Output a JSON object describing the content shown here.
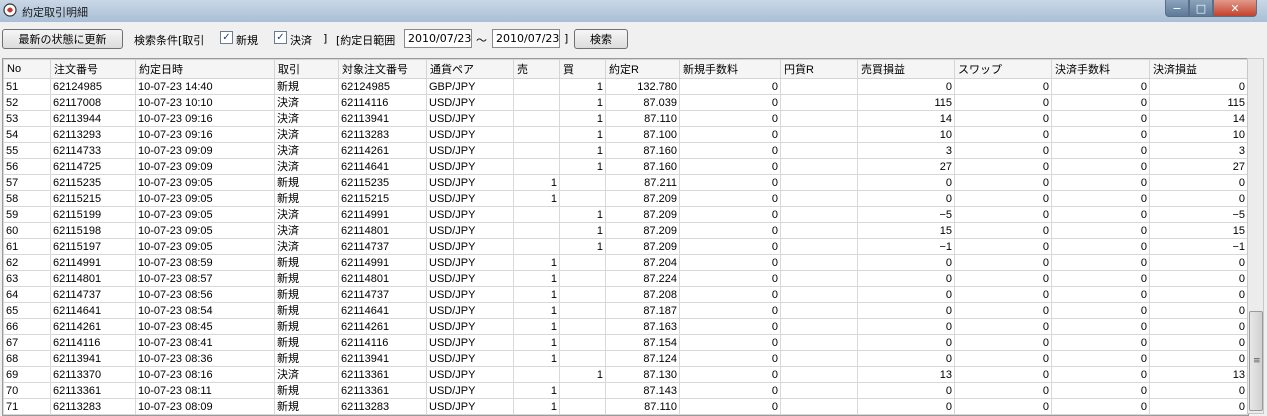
{
  "window": {
    "title": "約定取引明細",
    "buttons": {
      "minimize": "−",
      "maximize": "□",
      "close": "✕"
    }
  },
  "toolbar": {
    "refresh_label": "最新の状態に更新",
    "search_condition_label": "検索条件[取引",
    "new_label": "新規",
    "new_checked": true,
    "settle_label": "決済",
    "settle_checked": true,
    "bracket_close": "]",
    "date_range_label": "[約定日範囲",
    "date_from": "2010/07/23",
    "tilde": "〜",
    "date_to": "2010/07/23",
    "bracket_close2": "]",
    "search_label": "検索"
  },
  "table": {
    "columns": [
      "No",
      "注文番号",
      "約定日時",
      "取引",
      "対象注文番号",
      "通貨ペア",
      "売",
      "買",
      "約定R",
      "新規手数料",
      "円貨R",
      "売買損益",
      "スワップ",
      "決済手数料",
      "決済損益"
    ],
    "rows": [
      [
        "51",
        "62124985",
        "10-07-23 14:40",
        "新規",
        "62124985",
        "GBP/JPY",
        "",
        "1",
        "132.780",
        "0",
        "",
        "0",
        "0",
        "0",
        "0"
      ],
      [
        "52",
        "62117008",
        "10-07-23 10:10",
        "決済",
        "62114116",
        "USD/JPY",
        "",
        "1",
        "87.039",
        "0",
        "",
        "115",
        "0",
        "0",
        "115"
      ],
      [
        "53",
        "62113944",
        "10-07-23 09:16",
        "決済",
        "62113941",
        "USD/JPY",
        "",
        "1",
        "87.110",
        "0",
        "",
        "14",
        "0",
        "0",
        "14"
      ],
      [
        "54",
        "62113293",
        "10-07-23 09:16",
        "決済",
        "62113283",
        "USD/JPY",
        "",
        "1",
        "87.100",
        "0",
        "",
        "10",
        "0",
        "0",
        "10"
      ],
      [
        "55",
        "62114733",
        "10-07-23 09:09",
        "決済",
        "62114261",
        "USD/JPY",
        "",
        "1",
        "87.160",
        "0",
        "",
        "3",
        "0",
        "0",
        "3"
      ],
      [
        "56",
        "62114725",
        "10-07-23 09:09",
        "決済",
        "62114641",
        "USD/JPY",
        "",
        "1",
        "87.160",
        "0",
        "",
        "27",
        "0",
        "0",
        "27"
      ],
      [
        "57",
        "62115235",
        "10-07-23 09:05",
        "新規",
        "62115235",
        "USD/JPY",
        "1",
        "",
        "87.211",
        "0",
        "",
        "0",
        "0",
        "0",
        "0"
      ],
      [
        "58",
        "62115215",
        "10-07-23 09:05",
        "新規",
        "62115215",
        "USD/JPY",
        "1",
        "",
        "87.209",
        "0",
        "",
        "0",
        "0",
        "0",
        "0"
      ],
      [
        "59",
        "62115199",
        "10-07-23 09:05",
        "決済",
        "62114991",
        "USD/JPY",
        "",
        "1",
        "87.209",
        "0",
        "",
        "−5",
        "0",
        "0",
        "−5"
      ],
      [
        "60",
        "62115198",
        "10-07-23 09:05",
        "決済",
        "62114801",
        "USD/JPY",
        "",
        "1",
        "87.209",
        "0",
        "",
        "15",
        "0",
        "0",
        "15"
      ],
      [
        "61",
        "62115197",
        "10-07-23 09:05",
        "決済",
        "62114737",
        "USD/JPY",
        "",
        "1",
        "87.209",
        "0",
        "",
        "−1",
        "0",
        "0",
        "−1"
      ],
      [
        "62",
        "62114991",
        "10-07-23 08:59",
        "新規",
        "62114991",
        "USD/JPY",
        "1",
        "",
        "87.204",
        "0",
        "",
        "0",
        "0",
        "0",
        "0"
      ],
      [
        "63",
        "62114801",
        "10-07-23 08:57",
        "新規",
        "62114801",
        "USD/JPY",
        "1",
        "",
        "87.224",
        "0",
        "",
        "0",
        "0",
        "0",
        "0"
      ],
      [
        "64",
        "62114737",
        "10-07-23 08:56",
        "新規",
        "62114737",
        "USD/JPY",
        "1",
        "",
        "87.208",
        "0",
        "",
        "0",
        "0",
        "0",
        "0"
      ],
      [
        "65",
        "62114641",
        "10-07-23 08:54",
        "新規",
        "62114641",
        "USD/JPY",
        "1",
        "",
        "87.187",
        "0",
        "",
        "0",
        "0",
        "0",
        "0"
      ],
      [
        "66",
        "62114261",
        "10-07-23 08:45",
        "新規",
        "62114261",
        "USD/JPY",
        "1",
        "",
        "87.163",
        "0",
        "",
        "0",
        "0",
        "0",
        "0"
      ],
      [
        "67",
        "62114116",
        "10-07-23 08:41",
        "新規",
        "62114116",
        "USD/JPY",
        "1",
        "",
        "87.154",
        "0",
        "",
        "0",
        "0",
        "0",
        "0"
      ],
      [
        "68",
        "62113941",
        "10-07-23 08:36",
        "新規",
        "62113941",
        "USD/JPY",
        "1",
        "",
        "87.124",
        "0",
        "",
        "0",
        "0",
        "0",
        "0"
      ],
      [
        "69",
        "62113370",
        "10-07-23 08:16",
        "決済",
        "62113361",
        "USD/JPY",
        "",
        "1",
        "87.130",
        "0",
        "",
        "13",
        "0",
        "0",
        "13"
      ],
      [
        "70",
        "62113361",
        "10-07-23 08:11",
        "新規",
        "62113361",
        "USD/JPY",
        "1",
        "",
        "87.143",
        "0",
        "",
        "0",
        "0",
        "0",
        "0"
      ],
      [
        "71",
        "62113283",
        "10-07-23 08:09",
        "新規",
        "62113283",
        "USD/JPY",
        "1",
        "",
        "87.110",
        "0",
        "",
        "0",
        "0",
        "0",
        "0"
      ]
    ]
  },
  "scrollbar": {
    "grip": "≡"
  }
}
